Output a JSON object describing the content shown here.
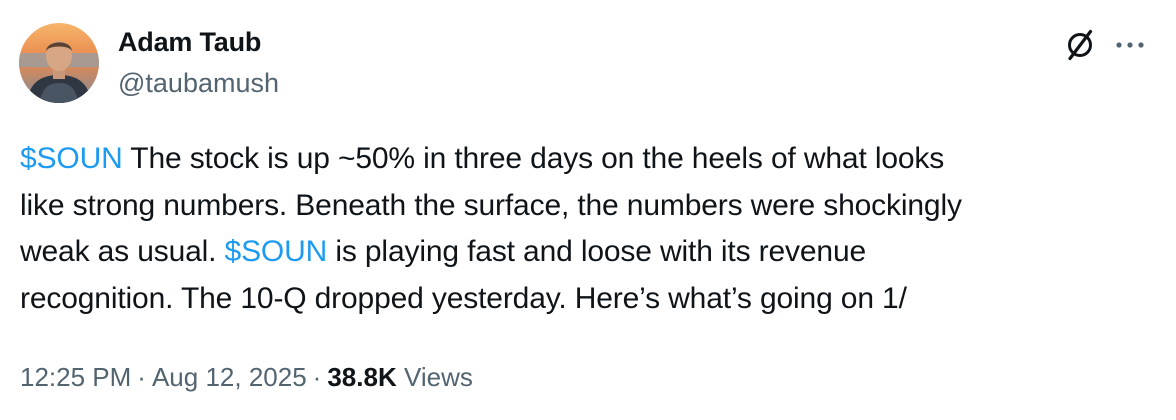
{
  "author": {
    "display_name": "Adam Taub",
    "handle": "@taubamush"
  },
  "icons": {
    "grok": "grok-icon",
    "more": "more-horizontal-icon",
    "avatar": "profile-photo"
  },
  "tweet": {
    "lines": [
      {
        "cashtag": "$SOUN",
        "text": " The stock is up ~50% in three days on the heels of what looks"
      },
      {
        "text": "like strong numbers.  Beneath the surface, the numbers were shockingly"
      },
      {
        "pre": "weak as usual. ",
        "cashtag": "$SOUN",
        "text": " is playing fast and loose with its revenue"
      },
      {
        "text": "recognition. The 10-Q dropped yesterday. Here’s what’s going on 1/"
      }
    ]
  },
  "meta": {
    "time": "12:25 PM",
    "separator": "·",
    "date": "Aug 12, 2025",
    "views_count": "38.8K",
    "views_label": "Views"
  },
  "colors": {
    "text": "#0f1419",
    "secondary": "#536471",
    "link": "#1d9bf0"
  }
}
